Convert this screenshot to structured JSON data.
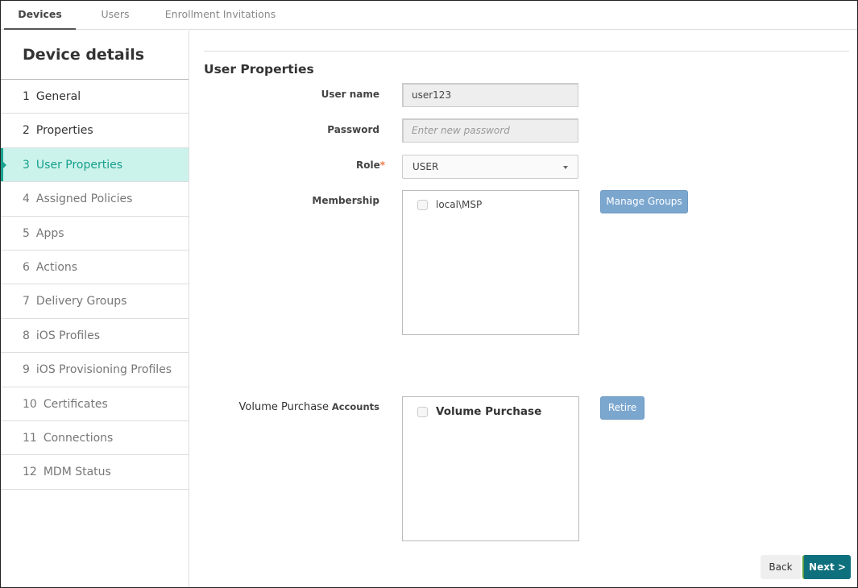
{
  "top_tabs": [
    {
      "label": "Devices",
      "active": true
    },
    {
      "label": "Users",
      "active": false
    },
    {
      "label": "Enrollment Invitations",
      "active": false
    }
  ],
  "sidebar": {
    "title": "Device details",
    "steps": [
      {
        "num": "1",
        "label": "General",
        "state": "done"
      },
      {
        "num": "2",
        "label": "Properties",
        "state": "done"
      },
      {
        "num": "3",
        "label": "User Properties",
        "state": "active"
      },
      {
        "num": "4",
        "label": "Assigned Policies",
        "state": "pending"
      },
      {
        "num": "5",
        "label": "Apps",
        "state": "pending"
      },
      {
        "num": "6",
        "label": "Actions",
        "state": "pending"
      },
      {
        "num": "7",
        "label": "Delivery Groups",
        "state": "pending"
      },
      {
        "num": "8",
        "label": "iOS Profiles",
        "state": "pending"
      },
      {
        "num": "9",
        "label": "iOS Provisioning Profiles",
        "state": "pending"
      },
      {
        "num": "10",
        "label": "Certificates",
        "state": "pending"
      },
      {
        "num": "11",
        "label": "Connections",
        "state": "pending"
      },
      {
        "num": "12",
        "label": "MDM Status",
        "state": "pending"
      }
    ]
  },
  "main": {
    "section_title": "User Properties",
    "username": {
      "label": "User name",
      "value": "user123"
    },
    "password": {
      "label": "Password",
      "placeholder": "Enter new password",
      "value": ""
    },
    "role": {
      "label": "Role",
      "required_mark": "*",
      "value": "USER"
    },
    "membership": {
      "label": "Membership",
      "items": [
        {
          "label": "local\\MSP",
          "checked": false
        }
      ],
      "button": "Manage Groups"
    },
    "vpp": {
      "label_main": "Volume Purchase",
      "label_suffix": "Accounts",
      "items": [
        {
          "label": "Volume Purchase",
          "checked": false
        }
      ],
      "button": "Retire"
    }
  },
  "footer": {
    "back": "Back",
    "next": "Next >"
  },
  "colors": {
    "accent_teal": "#1aa28f",
    "active_bg": "#ccf2ec",
    "next_button": "#0e6f7d",
    "secondary_button": "#7ba7cf",
    "required": "#f07a46"
  }
}
